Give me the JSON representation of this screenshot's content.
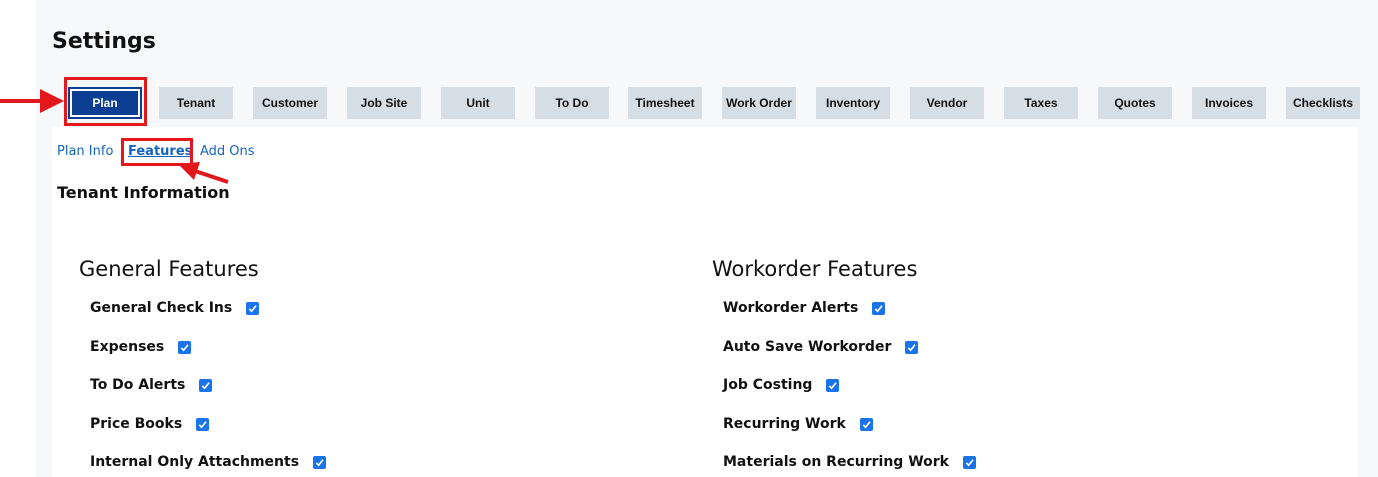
{
  "page": {
    "title": "Settings"
  },
  "tabs": [
    {
      "label": "Plan",
      "active": true
    },
    {
      "label": "Tenant"
    },
    {
      "label": "Customer"
    },
    {
      "label": "Job Site"
    },
    {
      "label": "Unit"
    },
    {
      "label": "To Do"
    },
    {
      "label": "Timesheet"
    },
    {
      "label": "Work Order"
    },
    {
      "label": "Inventory"
    },
    {
      "label": "Vendor"
    },
    {
      "label": "Taxes"
    },
    {
      "label": "Quotes"
    },
    {
      "label": "Invoices"
    },
    {
      "label": "Checklists"
    }
  ],
  "subnav": [
    {
      "label": "Plan Info"
    },
    {
      "label": "Features",
      "active": true
    },
    {
      "label": "Add Ons"
    }
  ],
  "section": {
    "title": "Tenant Information"
  },
  "general": {
    "title": "General Features",
    "items": [
      {
        "label": "General Check Ins",
        "checked": true
      },
      {
        "label": "Expenses",
        "checked": true
      },
      {
        "label": "To Do Alerts",
        "checked": true
      },
      {
        "label": "Price Books",
        "checked": true
      },
      {
        "label": "Internal Only Attachments",
        "checked": true
      }
    ]
  },
  "workorder": {
    "title": "Workorder Features",
    "items": [
      {
        "label": "Workorder Alerts",
        "checked": true
      },
      {
        "label": "Auto Save Workorder",
        "checked": true
      },
      {
        "label": "Job Costing",
        "checked": true
      },
      {
        "label": "Recurring Work",
        "checked": true
      },
      {
        "label": "Materials on Recurring Work",
        "checked": true
      }
    ]
  },
  "colors": {
    "accent": "#0c3f91",
    "tab_bg": "#d5dde5",
    "link": "#1565c0",
    "annotation": "#e3181d",
    "checkbox": "#1a73e8"
  },
  "icons": {
    "annotation_arrow": "arrow-right-icon",
    "checkbox": "check-icon"
  }
}
